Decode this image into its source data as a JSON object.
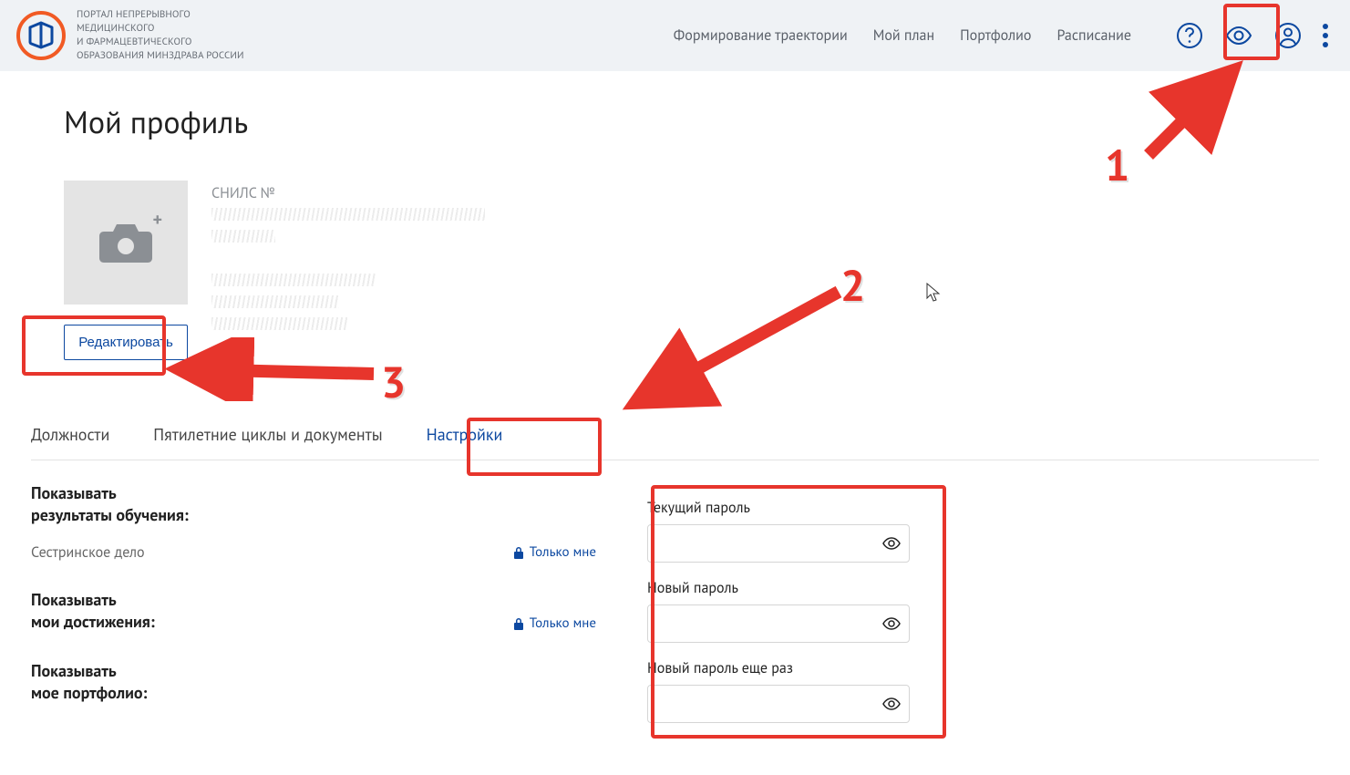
{
  "header": {
    "logo_text_line1": "ПОРТАЛ НЕПРЕРЫВНОГО",
    "logo_text_line2": "МЕДИЦИНСКОГО",
    "logo_text_line3": "И ФАРМАЦЕВТИЧЕСКОГО",
    "logo_text_line4": "ОБРАЗОВАНИЯ МИНЗДРАВА РОССИИ",
    "nav": {
      "trajectory": "Формирование траектории",
      "plan": "Мой план",
      "portfolio": "Портфолио",
      "schedule": "Расписание"
    }
  },
  "page": {
    "title": "Мой профиль",
    "snils_label": "СНИЛС №",
    "edit_button": "Редактировать"
  },
  "tabs": {
    "positions": "Должности",
    "cycles": "Пятилетние циклы и документы",
    "settings": "Настройки"
  },
  "settings": {
    "results_title_l1": "Показывать",
    "results_title_l2": "результаты обучения:",
    "nursing_label": "Сестринское дело",
    "only_me": "Только мне",
    "achievements_title_l1": "Показывать",
    "achievements_title_l2": "мои достижения:",
    "portfolio_title_l1": "Показывать",
    "portfolio_title_l2": "мое портфолио:"
  },
  "password": {
    "current_label": "Текущий пароль",
    "new_label": "Новый пароль",
    "again_label": "Новый пароль еще раз"
  },
  "annotations": {
    "n1": "1",
    "n2": "2",
    "n3": "3"
  }
}
